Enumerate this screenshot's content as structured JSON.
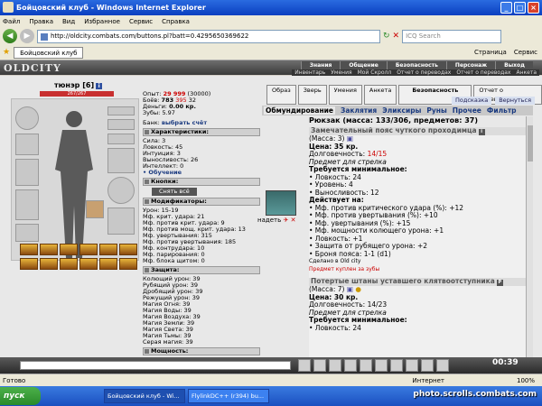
{
  "window": {
    "title": "Бойцовский клуб - Windows Internet Explorer"
  },
  "menu": [
    "Файл",
    "Правка",
    "Вид",
    "Избранное",
    "Сервис",
    "Справка"
  ],
  "address": {
    "url": "http://oldcity.combats.com/buttons.pl?batt=0.4295650369622",
    "search_placeholder": "ICQ Search"
  },
  "tab": {
    "label": "Бойцовский клуб"
  },
  "ie_tools": [
    "Страница",
    "Сервис"
  ],
  "game": {
    "logo": "OLDCITY",
    "nav": [
      "Знания",
      "Общение",
      "Безопасность",
      "Персонаж",
      "Выход"
    ],
    "subnav": [
      "Инвентарь",
      "Умения",
      "Мой Скролл",
      "Отчет о переводах",
      "Отчет о переводах",
      "Анкета"
    ]
  },
  "character": {
    "name": "тюнэр",
    "level": "[6]",
    "level_badge": "i",
    "hp": "267/267"
  },
  "stats": {
    "exp_label": "Опыт:",
    "exp": "29 999",
    "exp_next": "(30000)",
    "fights_label": "Боёв:",
    "fights": "783",
    "wins": "395",
    "draws": "32",
    "money_label": "Деньги:",
    "money": "0.00 кр.",
    "teeth_label": "Зубы:",
    "teeth": "5.97",
    "bank_label": "Банк:",
    "bank_link": "выбрать счёт"
  },
  "characteristics": {
    "header": "Характеристики:",
    "items": [
      "Сила: 3",
      "Ловкость: 45",
      "Интуиция: 3",
      "Выносливость: 26",
      "Интеллект: 0"
    ],
    "training": "• Обучение"
  },
  "buttons_section": {
    "header": "Кнопки:",
    "remove_all": "Снять всё"
  },
  "modifiers": {
    "header": "Модификаторы:",
    "items": [
      "Урон: 15-19",
      "Мф. крит. удара: 21",
      "Мф. против крит. удара: 9",
      "Мф. против мощ. крит. удара: 13",
      "Мф. увертывания: 315",
      "Мф. против увертывания: 185",
      "Мф. контрудара: 10",
      "Мф. парирования: 0",
      "Мф. блока щитом: 0"
    ]
  },
  "protection": {
    "header": "Защита:",
    "items": [
      "Колющий урон: 39",
      "Рубящий урон: 39",
      "Дробящий урон: 39",
      "Режущий урон: 39",
      "Магия Огня: 39",
      "Магия Воды: 39",
      "Магия Воздуха: 39",
      "Магия Земли: 39",
      "Магия Света: 39",
      "Магия Тьмы: 39",
      "Серая магия: 39"
    ]
  },
  "power": {
    "header": "Мощность:"
  },
  "right_tabs": [
    "Образ",
    "Зверь",
    "Умения",
    "Анкета",
    "Безопасность",
    "Отчет о переводах"
  ],
  "right_tabs2": [
    "Подсказка",
    "Вернуться"
  ],
  "inventory_tabs": [
    "Обмундирование",
    "Заклятия",
    "Эликсиры",
    "Руны",
    "Прочее",
    "Фильтр"
  ],
  "backpack": "Рюкзак (масса: 133/306, предметов: 37)",
  "put_on": "надеть",
  "item1": {
    "title": "Замечательный пояс чуткого проходимца",
    "mass": "(Масса: 3)",
    "price": "Цена: 35 кр.",
    "durability_label": "Долговечность:",
    "durability": "14/15",
    "purpose": "Предмет для стрелка",
    "req_header": "Требуется минимальное:",
    "req": [
      "• Ловкость: 24",
      "• Уровень: 4",
      "• Выносливость: 12"
    ],
    "act_header": "Действует на:",
    "act": [
      "• Мф. против критического удара (%): +12",
      "• Мф. против увертывания (%): +10",
      "• Мф. увертывания (%): +15",
      "• Мф. мощности колющего урона: +1",
      "• Ловкость: +1",
      "• Защита от рубящего урона: +2",
      "• Броня пояса: 1-1 (d1)"
    ],
    "made_in": "Сделано в Old city",
    "bought": "Предмет куплен за зубы"
  },
  "item2": {
    "title": "Потертые штаны уставшего клятвоотступника",
    "mass": "(Масса: 7)",
    "price": "Цена: 30 кр.",
    "durability_label": "Долговечность:",
    "durability": "14/23",
    "purpose": "Предмет для стрелка",
    "req_header": "Требуется минимальное:",
    "req": [
      "• Ловкость: 24"
    ]
  },
  "clock": "00:39",
  "status": {
    "left": "Готово",
    "zone": "Интернет",
    "zoom": "100%"
  },
  "taskbar": {
    "start": "пуск",
    "tasks": [
      "Бойцовский клуб - Wi...",
      "FlylinkDC++ (r394) bu..."
    ],
    "watermark": "photo.scrolls.combats.com"
  }
}
